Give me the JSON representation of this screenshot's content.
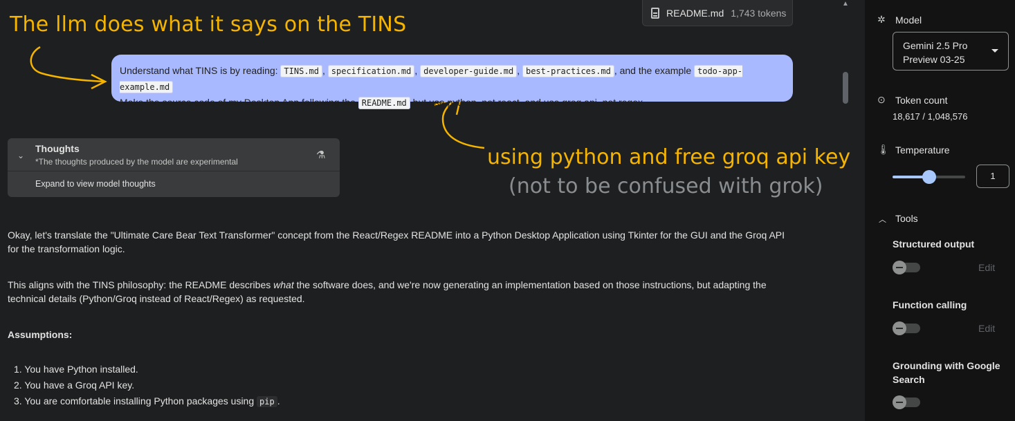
{
  "attachment": {
    "name": "README.md",
    "tokens": "1,743 tokens"
  },
  "annotations": {
    "title": "The llm does what it says on the TINS",
    "python": "using python and free groq api key",
    "grok": "(not to be confused with grok)"
  },
  "user_message": {
    "line1_pre": "Understand what TINS is by reading: ",
    "files": [
      "TINS.md",
      "specification.md",
      "developer-guide.md",
      "best-practices.md"
    ],
    "sep": ", ",
    "line1_mid": ", and the example ",
    "example_file": "todo-app-example.md",
    "line2_pre": "Make the source code of my Desktop App following the ",
    "readme": "README.md",
    "line2_post": " but use python, not react, and use groq api, not regex"
  },
  "thoughts": {
    "title": "Thoughts",
    "subtitle": "*The thoughts produced by the model are experimental",
    "expand": "Expand to view model thoughts"
  },
  "response": {
    "p1": "Okay, let's translate the \"Ultimate Care Bear Text Transformer\" concept from the React/Regex README into a Python Desktop Application using Tkinter for the GUI and the Groq API for the transformation logic.",
    "p2_pre": "This aligns with the TINS philosophy: the README describes ",
    "p2_em": "what",
    "p2_post": " the software does, and we're now generating an implementation based on those instructions, but adapting the technical details (Python/Groq instead of React/Regex) as requested.",
    "assumptions": "Assumptions:",
    "list": [
      {
        "num": "1.",
        "text": "You have Python installed."
      },
      {
        "num": "2.",
        "text": "You have a Groq API key."
      },
      {
        "num": "3.",
        "text": "You are comfortable installing Python packages using ",
        "code": "pip",
        "tail": "."
      }
    ]
  },
  "sidebar": {
    "model_label": "Model",
    "model_value_line1": "Gemini 2.5 Pro",
    "model_value_line2": "Preview 03-25",
    "token_label": "Token count",
    "token_value": "18,617 / 1,048,576",
    "temperature_label": "Temperature",
    "temperature_value": "1",
    "temperature_fraction": 0.5,
    "tools_label": "Tools",
    "tools": [
      {
        "name": "Structured output",
        "edit": "Edit"
      },
      {
        "name": "Function calling",
        "edit": "Edit"
      },
      {
        "name": "Grounding with Google Search"
      }
    ]
  },
  "colors": {
    "accent": "#a8b9ff",
    "annotation": "#f4b400",
    "slider": "#a8c7fa"
  }
}
